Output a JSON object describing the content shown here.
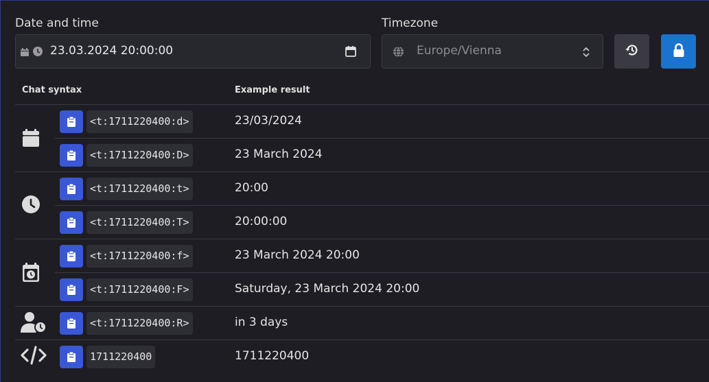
{
  "form": {
    "datetime_label": "Date and time",
    "datetime_value": "23.03.2024 20:00:00",
    "timezone_label": "Timezone",
    "timezone_value": "Europe/Vienna"
  },
  "table": {
    "col_syntax": "Chat syntax",
    "col_result": "Example result",
    "rows": [
      {
        "code": "<t:1711220400:d>",
        "result": "23/03/2024"
      },
      {
        "code": "<t:1711220400:D>",
        "result": "23 March 2024"
      },
      {
        "code": "<t:1711220400:t>",
        "result": "20:00"
      },
      {
        "code": "<t:1711220400:T>",
        "result": "20:00:00"
      },
      {
        "code": "<t:1711220400:f>",
        "result": "23 March 2024 20:00"
      },
      {
        "code": "<t:1711220400:F>",
        "result": "Saturday, 23 March 2024 20:00"
      },
      {
        "code": "<t:1711220400:R>",
        "result": "in 3 days"
      },
      {
        "code": "1711220400",
        "result": "1711220400"
      }
    ],
    "group_icons": [
      "calendar-icon",
      "clock-icon",
      "calendar-clock-icon",
      "user-clock-icon",
      "code-icon"
    ]
  },
  "colors": {
    "background": "#1d1d23",
    "copy_button": "#3a57d6",
    "lock_button": "#1a73cf",
    "reset_button": "#3a3b42"
  }
}
